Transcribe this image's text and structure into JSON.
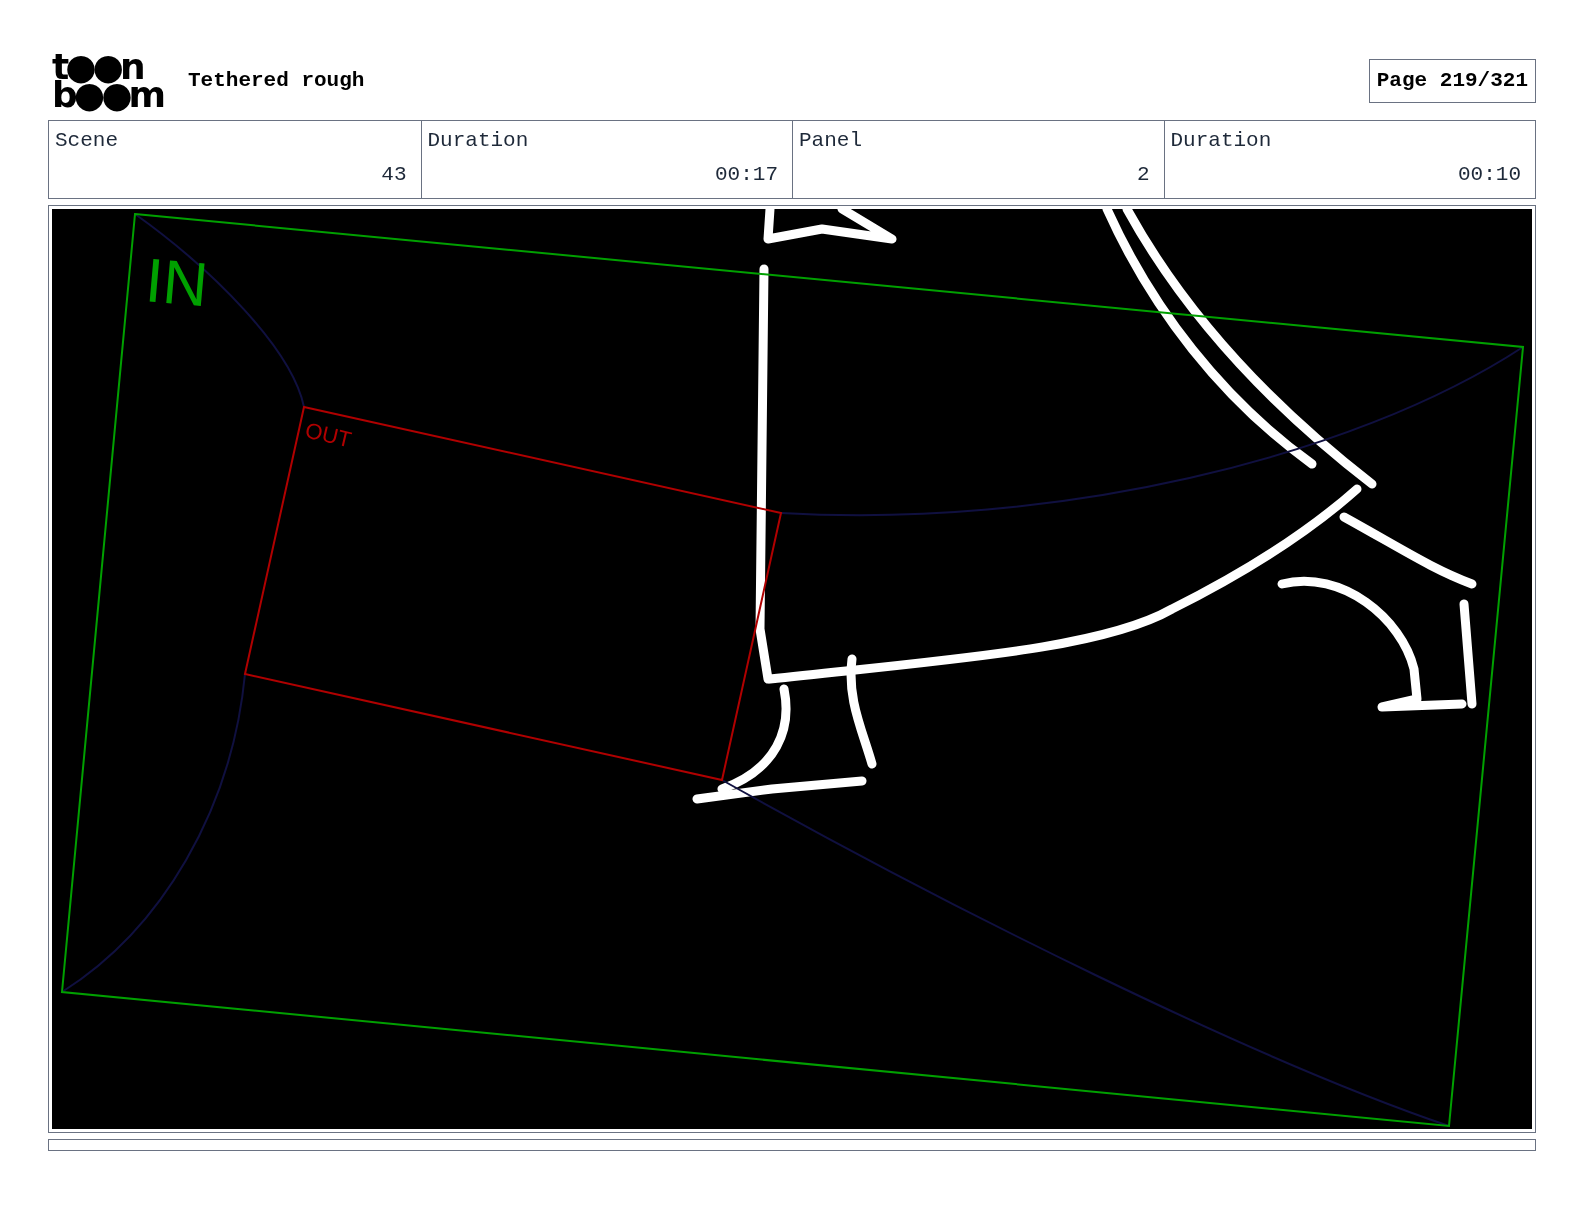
{
  "header": {
    "logo": {
      "line_1": "t●●n",
      "line_2": "b●●m"
    },
    "title": "Tethered rough",
    "page": "Page 219/321"
  },
  "info": [
    {
      "label": "Scene",
      "value": "43"
    },
    {
      "label": "Duration",
      "value": "00:17"
    },
    {
      "label": "Panel",
      "value": "2"
    },
    {
      "label": "Duration",
      "value": "00:10"
    }
  ],
  "panel": {
    "camera_frames": [
      {
        "label": "IN",
        "color": "#00a000"
      },
      {
        "label": "OUT",
        "color": "#b00000"
      }
    ]
  }
}
